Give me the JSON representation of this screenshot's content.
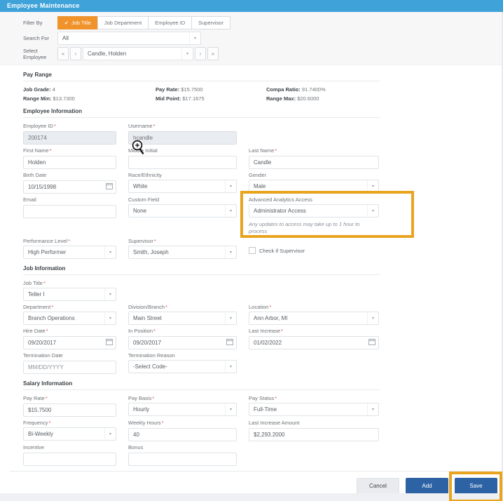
{
  "ui": {
    "required_marker": "*",
    "dropdown_arrow": "▾",
    "check_icon": "✔",
    "nav_first": "«",
    "nav_prev": "‹",
    "nav_next": "›",
    "nav_last": "»"
  },
  "colors": {
    "header_blue": "#3fa2d9",
    "active_tab_orange": "#f0932b",
    "annotation_highlight_orange": "#e9a41f",
    "primary_button_blue": "#2d63a5",
    "required_red": "#e2574c"
  },
  "header": {
    "title": "Employee Maintenance"
  },
  "filter": {
    "filter_by_label": "Filter By",
    "tab_job_title": "Job Title",
    "tab_job_department": "Job Department",
    "tab_employee_id": "Employee ID",
    "tab_supervisor": "Supervisor",
    "search_for_label": "Search For",
    "search_for_value": "All",
    "select_employee_label": "Select Employee",
    "select_employee_value": "Candle, Holden"
  },
  "pay_range": {
    "title": "Pay Range",
    "job_grade_label": "Job Grade:",
    "job_grade_value": "4",
    "pay_rate_label": "Pay Rate:",
    "pay_rate_value": "$15.7500",
    "compa_ratio_label": "Compa Ratio:",
    "compa_ratio_value": "91.7400%",
    "range_min_label": "Range Min:",
    "range_min_value": "$13.7300",
    "mid_point_label": "Mid Point:",
    "mid_point_value": "$17.1675",
    "range_max_label": "Range Max:",
    "range_max_value": "$20.6000"
  },
  "employee_info": {
    "title": "Employee Information",
    "employee_id_label": "Employee ID",
    "employee_id_value": "200174",
    "username_label": "Username",
    "username_value": "hcandle",
    "first_name_label": "First Name",
    "first_name_value": "Holden",
    "middle_initial_label": "Middle Initial",
    "middle_initial_value": "",
    "last_name_label": "Last Name",
    "last_name_value": "Candle",
    "birth_date_label": "Birth Date",
    "birth_date_value": "10/15/1998",
    "race_label": "Race/Ethnicity",
    "race_value": "White",
    "gender_label": "Gender",
    "gender_value": "Male",
    "email_label": "Email",
    "email_value": "",
    "custom_field_label": "Custom Field",
    "custom_field_value": "None",
    "analytics_label": "Advanced Analytics Access",
    "analytics_value": "Administrator Access",
    "analytics_note": "Any updates to access may take up to 1 hour to process",
    "performance_label": "Performance Level",
    "performance_value": "High Performer",
    "supervisor_label": "Supervisor",
    "supervisor_value": "Smith, Joseph",
    "check_if_supervisor_label": "Check if Supervisor"
  },
  "job_info": {
    "title": "Job Information",
    "job_title_label": "Job Title",
    "job_title_value": "Teller I",
    "department_label": "Department",
    "department_value": "Branch Operations",
    "division_label": "Division/Branch",
    "division_value": "Main Street",
    "location_label": "Location",
    "location_value": "Ann Arbor, MI",
    "hire_date_label": "Hire Date",
    "hire_date_value": "09/20/2017",
    "in_position_label": "In Position",
    "in_position_value": "09/20/2017",
    "last_increase_label": "Last Increase",
    "last_increase_value": "01/02/2022",
    "termination_date_label": "Termination Date",
    "termination_date_placeholder": "MM/DD/YYYY",
    "termination_reason_label": "Termination Reason",
    "termination_reason_value": "-Select Code-"
  },
  "salary_info": {
    "title": "Salary Information",
    "pay_rate_label": "Pay Rate",
    "pay_rate_value": "$15.7500",
    "pay_basis_label": "Pay Basis",
    "pay_basis_value": "Hourly",
    "pay_status_label": "Pay Status",
    "pay_status_value": "Full-Time",
    "frequency_label": "Frequency",
    "frequency_value": "Bi-Weekly",
    "weekly_hours_label": "Weekly Hours",
    "weekly_hours_value": "40",
    "last_increase_amount_label": "Last Increase Amount",
    "last_increase_amount_value": "$2,293.2000",
    "incentive_label": "Incentive",
    "incentive_value": "",
    "bonus_label": "Bonus",
    "bonus_value": ""
  },
  "footer": {
    "cancel_label": "Cancel",
    "add_label": "Add",
    "save_label": "Save"
  }
}
